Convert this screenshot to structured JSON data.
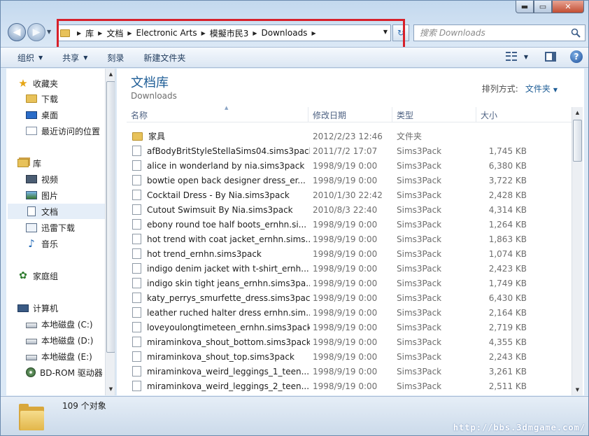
{
  "window_controls": {
    "minimize": "▬",
    "maximize": "▭",
    "close": "✕"
  },
  "address": {
    "crumbs": [
      "库",
      "文档",
      "Electronic Arts",
      "模擬市民3",
      "Downloads"
    ]
  },
  "search": {
    "placeholder": "搜索 Downloads"
  },
  "toolbar": {
    "organize": "组织",
    "share": "共享",
    "burn": "刻录",
    "new_folder": "新建文件夹"
  },
  "sidebar": {
    "favorites": "收藏夹",
    "downloads": "下载",
    "desktop": "桌面",
    "recent": "最近访问的位置",
    "libraries": "库",
    "videos": "视频",
    "pictures": "图片",
    "documents": "文档",
    "xunlei": "迅雷下载",
    "music": "音乐",
    "homegroup": "家庭组",
    "computer": "计算机",
    "drive_c": "本地磁盘 (C:)",
    "drive_d": "本地磁盘 (D:)",
    "drive_e": "本地磁盘 (E:)",
    "bdrom": "BD-ROM 驱动器"
  },
  "library": {
    "title": "文档库",
    "subtitle": "Downloads",
    "arrange_label": "排列方式:",
    "arrange_value": "文件夹"
  },
  "columns": {
    "name": "名称",
    "date": "修改日期",
    "type": "类型",
    "size": "大小"
  },
  "files": [
    {
      "name": "家具",
      "date": "2012/2/23 12:46",
      "type": "文件夹",
      "size": "",
      "folder": true
    },
    {
      "name": "afBodyBritStyleStellaSims04.sims3pack",
      "date": "2011/7/2 17:07",
      "type": "Sims3Pack",
      "size": "1,745 KB"
    },
    {
      "name": "alice in wonderland by nia.sims3pack",
      "date": "1998/9/19 0:00",
      "type": "Sims3Pack",
      "size": "6,380 KB"
    },
    {
      "name": "bowtie open back designer dress_er...",
      "date": "1998/9/19 0:00",
      "type": "Sims3Pack",
      "size": "3,722 KB"
    },
    {
      "name": "Cocktail Dress - By Nia.sims3pack",
      "date": "2010/1/30 22:42",
      "type": "Sims3Pack",
      "size": "2,428 KB"
    },
    {
      "name": "Cutout Swimsuit By Nia.sims3pack",
      "date": "2010/8/3 22:40",
      "type": "Sims3Pack",
      "size": "4,314 KB"
    },
    {
      "name": "ebony round toe half boots_ernhn.si...",
      "date": "1998/9/19 0:00",
      "type": "Sims3Pack",
      "size": "1,264 KB"
    },
    {
      "name": "hot trend with coat jacket_ernhn.sims...",
      "date": "1998/9/19 0:00",
      "type": "Sims3Pack",
      "size": "1,863 KB"
    },
    {
      "name": "hot trend_ernhn.sims3pack",
      "date": "1998/9/19 0:00",
      "type": "Sims3Pack",
      "size": "1,074 KB"
    },
    {
      "name": "indigo denim jacket with t-shirt_ernh...",
      "date": "1998/9/19 0:00",
      "type": "Sims3Pack",
      "size": "2,423 KB"
    },
    {
      "name": "indigo skin tight jeans_ernhn.sims3pa...",
      "date": "1998/9/19 0:00",
      "type": "Sims3Pack",
      "size": "1,749 KB"
    },
    {
      "name": "katy_perrys_smurfette_dress.sims3pack",
      "date": "1998/9/19 0:00",
      "type": "Sims3Pack",
      "size": "6,430 KB"
    },
    {
      "name": "leather ruched halter dress ernhn.sim...",
      "date": "1998/9/19 0:00",
      "type": "Sims3Pack",
      "size": "2,164 KB"
    },
    {
      "name": "loveyoulongtimeteen_ernhn.sims3pack",
      "date": "1998/9/19 0:00",
      "type": "Sims3Pack",
      "size": "2,719 KB"
    },
    {
      "name": "miraminkova_shout_bottom.sims3pack",
      "date": "1998/9/19 0:00",
      "type": "Sims3Pack",
      "size": "4,355 KB"
    },
    {
      "name": "miraminkova_shout_top.sims3pack",
      "date": "1998/9/19 0:00",
      "type": "Sims3Pack",
      "size": "2,243 KB"
    },
    {
      "name": "miraminkova_weird_leggings_1_teen....",
      "date": "1998/9/19 0:00",
      "type": "Sims3Pack",
      "size": "3,261 KB"
    },
    {
      "name": "miraminkova_weird_leggings_2_teen....",
      "date": "1998/9/19 0:00",
      "type": "Sims3Pack",
      "size": "2,511 KB"
    }
  ],
  "status": {
    "count_text": "109 个对象"
  },
  "watermark": "http://bbs.3dmgame.com/"
}
